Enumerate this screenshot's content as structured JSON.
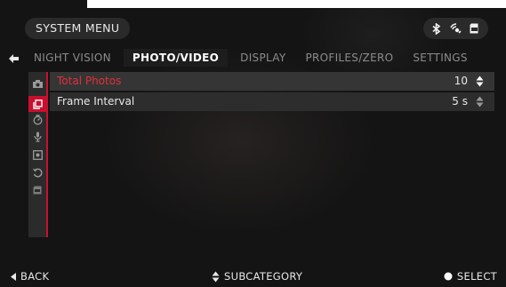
{
  "window": {
    "title": "SYSTEM MENU"
  },
  "status_icons": [
    "bluetooth-icon",
    "wifi-icon",
    "sd-card-icon"
  ],
  "tabs": [
    {
      "label": "NIGHT VISION",
      "active": false
    },
    {
      "label": "PHOTO/VIDEO",
      "active": true
    },
    {
      "label": "DISPLAY",
      "active": false
    },
    {
      "label": "PROFILES/ZERO",
      "active": false
    },
    {
      "label": "SETTINGS",
      "active": false
    }
  ],
  "sidebar": {
    "items": [
      {
        "icon": "camera-icon",
        "active": false
      },
      {
        "icon": "frames-icon",
        "active": true
      },
      {
        "icon": "timer-icon",
        "active": false
      },
      {
        "icon": "microphone-icon",
        "active": false
      },
      {
        "icon": "video-settings-icon",
        "active": false
      },
      {
        "icon": "loop-icon",
        "active": false
      },
      {
        "icon": "sd-card-icon",
        "active": false
      }
    ]
  },
  "rows": [
    {
      "label": "Total Photos",
      "value": "10",
      "selected": true
    },
    {
      "label": "Frame Interval",
      "value": "5 s",
      "selected": false
    }
  ],
  "footer": {
    "back": "BACK",
    "subcategory": "SUBCATEGORY",
    "select": "SELECT"
  },
  "colors": {
    "accent": "#c8102e",
    "background": "#141414",
    "panel": "#2d2d2d"
  }
}
